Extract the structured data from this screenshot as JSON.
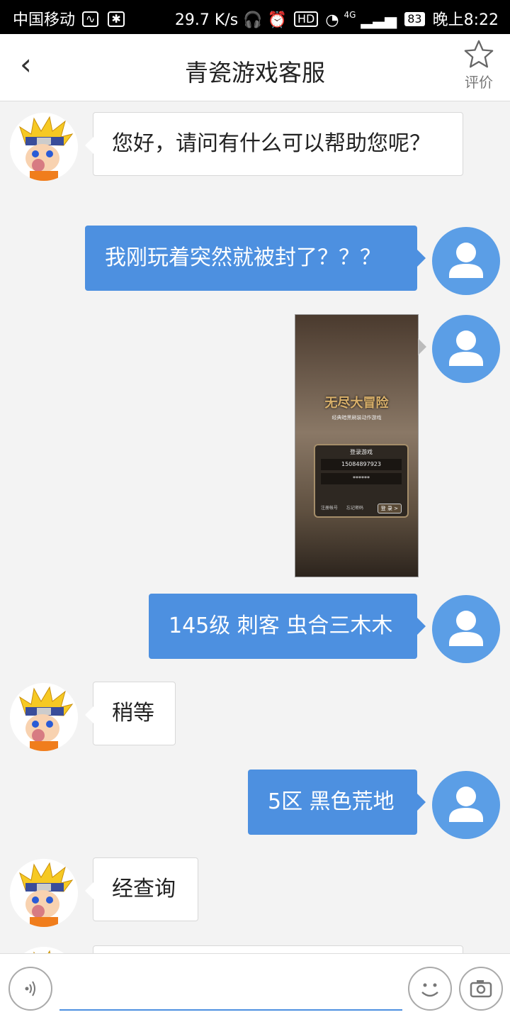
{
  "status_bar": {
    "carrier": "中国移动",
    "speed": "29.7 K/s",
    "network": "4G",
    "battery": "83",
    "time": "晚上8:22",
    "hd": "HD"
  },
  "header": {
    "back_icon": "‹",
    "title": "青瓷游戏客服",
    "rate_label": "评价"
  },
  "messages": {
    "m1": "您好，请问有什么可以帮助您呢？",
    "m2": "我刚玩着突然就被封了？？？",
    "m3_image_text": {
      "game_title": "无尽大冒险",
      "subtitle": "经典暗黑刷装动作游戏",
      "login_title": "登录游戏",
      "account": "15084897923",
      "password": "******",
      "register": "注册帐号",
      "forgot": "忘记密码",
      "login_btn": "登 录 >"
    },
    "m4": "145级 刺客 虫合三木木",
    "m5": "稍等",
    "m6": "5区 黑色荒地",
    "m7": "经查询"
  },
  "input": {
    "placeholder": ""
  }
}
